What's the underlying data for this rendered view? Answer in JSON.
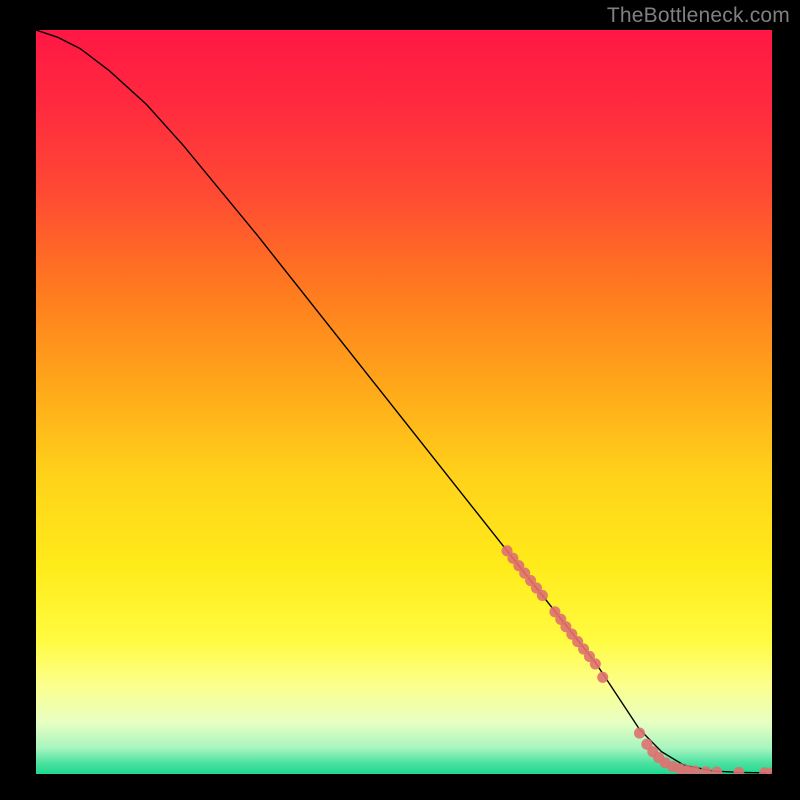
{
  "attribution": "TheBottleneck.com",
  "colors": {
    "curve": "#000000",
    "marker": "#e07070",
    "marker_stroke": "#e07070",
    "frame": "#000000"
  },
  "chart_data": {
    "type": "line",
    "title": "",
    "xlabel": "",
    "ylabel": "",
    "xlim": [
      0,
      100
    ],
    "ylim": [
      0,
      100
    ],
    "grid": false,
    "legend": false,
    "curve": {
      "x": [
        0,
        3,
        6,
        10,
        15,
        20,
        30,
        40,
        50,
        60,
        70,
        76,
        80,
        82,
        85,
        88,
        92,
        96,
        100
      ],
      "y": [
        100,
        99,
        97.5,
        94.5,
        90,
        84.5,
        72.5,
        60,
        47.5,
        35,
        22.5,
        15,
        9,
        6,
        3,
        1.2,
        0.4,
        0.2,
        0.15
      ]
    },
    "markers": [
      {
        "x": 64.0,
        "y": 30.0
      },
      {
        "x": 64.8,
        "y": 29.0
      },
      {
        "x": 65.6,
        "y": 28.0
      },
      {
        "x": 66.4,
        "y": 27.0
      },
      {
        "x": 67.2,
        "y": 26.0
      },
      {
        "x": 68.0,
        "y": 25.0
      },
      {
        "x": 68.8,
        "y": 24.0
      },
      {
        "x": 70.5,
        "y": 21.8
      },
      {
        "x": 71.3,
        "y": 20.8
      },
      {
        "x": 72.0,
        "y": 19.8
      },
      {
        "x": 72.8,
        "y": 18.8
      },
      {
        "x": 73.6,
        "y": 17.8
      },
      {
        "x": 74.4,
        "y": 16.8
      },
      {
        "x": 75.2,
        "y": 15.8
      },
      {
        "x": 76.0,
        "y": 14.8
      },
      {
        "x": 77.0,
        "y": 13.0
      },
      {
        "x": 82.0,
        "y": 5.5
      },
      {
        "x": 83.0,
        "y": 4.0
      },
      {
        "x": 83.8,
        "y": 3.0
      },
      {
        "x": 84.6,
        "y": 2.2
      },
      {
        "x": 85.5,
        "y": 1.5
      },
      {
        "x": 86.5,
        "y": 1.0
      },
      {
        "x": 87.5,
        "y": 0.7
      },
      {
        "x": 88.5,
        "y": 0.5
      },
      {
        "x": 89.5,
        "y": 0.4
      },
      {
        "x": 91.0,
        "y": 0.3
      },
      {
        "x": 92.5,
        "y": 0.25
      },
      {
        "x": 95.5,
        "y": 0.2
      },
      {
        "x": 99.0,
        "y": 0.15
      },
      {
        "x": 100.0,
        "y": 0.15
      }
    ],
    "gradient_stops": [
      {
        "offset": 0.0,
        "color": "#ff1744"
      },
      {
        "offset": 0.1,
        "color": "#ff2a3f"
      },
      {
        "offset": 0.22,
        "color": "#ff4a33"
      },
      {
        "offset": 0.35,
        "color": "#ff7a1f"
      },
      {
        "offset": 0.48,
        "color": "#ffa81a"
      },
      {
        "offset": 0.6,
        "color": "#ffd21a"
      },
      {
        "offset": 0.72,
        "color": "#ffeb1a"
      },
      {
        "offset": 0.82,
        "color": "#fffb40"
      },
      {
        "offset": 0.88,
        "color": "#fcff8c"
      },
      {
        "offset": 0.93,
        "color": "#e8ffc2"
      },
      {
        "offset": 0.965,
        "color": "#a8f5c0"
      },
      {
        "offset": 0.985,
        "color": "#4de2a0"
      },
      {
        "offset": 1.0,
        "color": "#1fd890"
      }
    ]
  }
}
